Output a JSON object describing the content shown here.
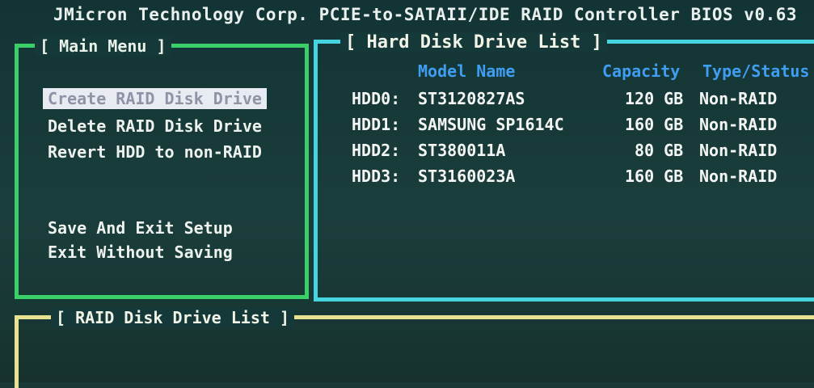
{
  "title": "JMicron Technology Corp. PCIE-to-SATAII/IDE RAID Controller BIOS v0.63",
  "main_menu": {
    "heading": "[ Main Menu ]",
    "items": [
      {
        "label": "Create RAID Disk Drive",
        "selected": true
      },
      {
        "label": "Delete RAID Disk Drive",
        "selected": false
      },
      {
        "label": "Revert HDD to non-RAID",
        "selected": false
      },
      {
        "label": "Save And Exit Setup",
        "selected": false
      },
      {
        "label": "Exit Without Saving",
        "selected": false
      }
    ]
  },
  "hdd_list": {
    "heading": "[ Hard Disk Drive List ]",
    "columns": {
      "model": "Model Name",
      "capacity": "Capacity",
      "type": "Type/Status"
    },
    "rows": [
      {
        "id": "HDD0:",
        "model": "ST3120827AS",
        "capacity": "120 GB",
        "type": "Non-RAID"
      },
      {
        "id": "HDD1:",
        "model": "SAMSUNG SP1614C",
        "capacity": "160 GB",
        "type": "Non-RAID"
      },
      {
        "id": "HDD2:",
        "model": "ST380011A",
        "capacity": "80 GB",
        "type": "Non-RAID"
      },
      {
        "id": "HDD3:",
        "model": "ST3160023A",
        "capacity": "160 GB",
        "type": "Non-RAID"
      }
    ]
  },
  "raid_list": {
    "heading": "[ RAID Disk Drive List ]"
  },
  "colors": {
    "menu_border": "#3bcf6a",
    "hdd_border": "#46d4e0",
    "raid_border": "#e6e292",
    "column_header": "#3f9df2",
    "selection_bg": "#e8ebf2"
  }
}
